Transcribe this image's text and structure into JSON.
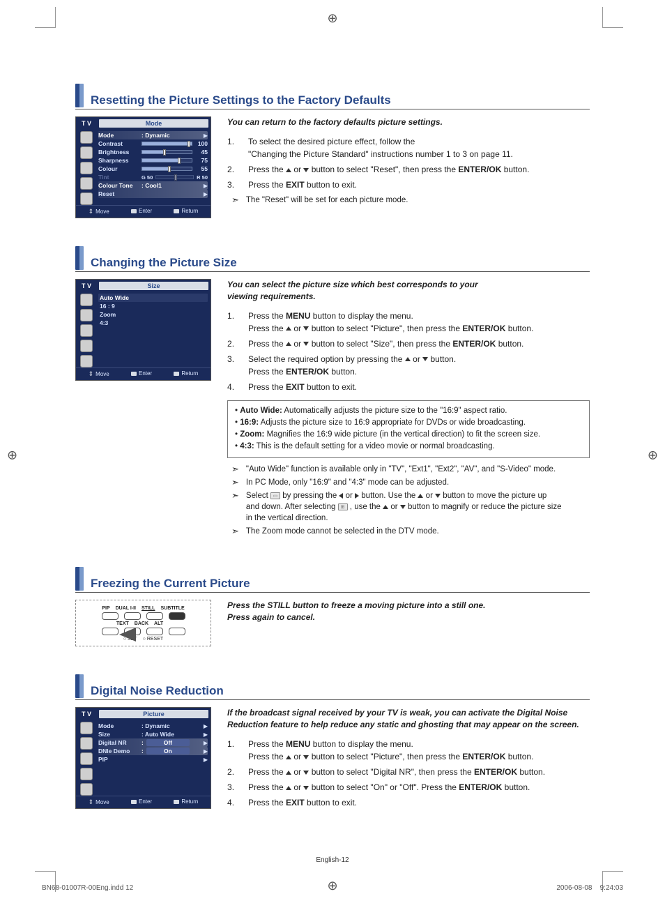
{
  "sections": {
    "s1": {
      "title": "Resetting the Picture Settings to the Factory Defaults",
      "intro": "You can return to the factory defaults picture settings.",
      "osd": {
        "tv": "T V",
        "menu_title": "Mode",
        "rows": {
          "mode": {
            "label": "Mode",
            "value": ": Dynamic"
          },
          "contrast": {
            "label": "Contrast",
            "num": "100"
          },
          "brightness": {
            "label": "Brightness",
            "num": "45"
          },
          "sharpness": {
            "label": "Sharpness",
            "num": "75"
          },
          "colour": {
            "label": "Colour",
            "num": "55"
          },
          "tint": {
            "label": "Tint",
            "left": "G 50",
            "right": "R 50"
          },
          "colour_tone": {
            "label": "Colour Tone",
            "value": ": Cool1"
          },
          "reset": {
            "label": "Reset"
          }
        },
        "foot": {
          "move": "Move",
          "enter": "Enter",
          "ret": "Return"
        }
      },
      "steps": {
        "i1": "To select the desired picture effect, follow the",
        "i1b": "\"Changing the Picture Standard\" instructions number 1 to 3 on page 11.",
        "i2a": "Press the ",
        "i2b": " or ",
        "i2c": " button to select \"Reset\", then press the ",
        "i2d": "ENTER/OK",
        "i2e": " button.",
        "i3a": "Press the ",
        "i3b": "EXIT",
        "i3c": " button to exit."
      },
      "note": "The \"Reset\" will be set for each picture mode."
    },
    "s2": {
      "title": "Changing the Picture Size",
      "intro_a": "You can select the picture size which best corresponds to your",
      "intro_b": "viewing requirements.",
      "osd": {
        "tv": "T V",
        "menu_title": "Size",
        "items": {
          "i0": "Auto Wide",
          "i1": "16 : 9",
          "i2": "Zoom",
          "i3": "4:3"
        },
        "foot": {
          "move": "Move",
          "enter": "Enter",
          "ret": "Return"
        }
      },
      "steps": {
        "i1a": "Press the ",
        "i1b": "MENU",
        "i1c": " button to display the menu.",
        "i1d": "Press the ",
        "i1e": " or ",
        "i1f": " button to select \"Picture\", then press the ",
        "i1g": "ENTER/OK",
        "i1h": " button.",
        "i2a": "Press the ",
        "i2b": " or ",
        "i2c": " button to select \"Size\", then press the ",
        "i2d": "ENTER/OK",
        "i2e": " button.",
        "i3a": "Select the required option by pressing the ",
        "i3b": " or ",
        "i3c": " button.",
        "i3d": "Press the ",
        "i3e": "ENTER/OK",
        "i3f": " button.",
        "i4a": "Press the ",
        "i4b": "EXIT",
        "i4c": " button to exit."
      },
      "box": {
        "b1a": "Auto Wide:",
        "b1b": " Automatically adjusts the picture size to the \"16:9\" aspect ratio.",
        "b2a": "16:9:",
        "b2b": " Adjusts the picture size to 16:9 appropriate for DVDs or wide broadcasting.",
        "b3a": "Zoom:",
        "b3b": " Magnifies the 16:9 wide picture (in the vertical direction) to fit the screen size.",
        "b4a": "4:3:",
        "b4b": " This is the default setting for a video movie or normal broadcasting."
      },
      "notes": {
        "n1": "\"Auto Wide\" function is available only in \"TV\", \"Ext1\", \"Ext2\", \"AV\", and \"S-Video\" mode.",
        "n2": "In PC Mode, only \"16:9\" and \"4:3\" mode can be adjusted.",
        "n3a": "Select ",
        "n3b": " by pressing the ",
        "n3c": " or ",
        "n3d": " button. Use the ",
        "n3e": " or ",
        "n3f": " button to move the picture up",
        "n3g": "and down.  After selecting ",
        "n3h": " , use the ",
        "n3i": " or ",
        "n3j": " button to magnify or reduce the picture size",
        "n3k": "in the vertical direction.",
        "n4": "The Zoom mode cannot be selected in the DTV mode."
      }
    },
    "s3": {
      "title": "Freezing the Current Picture",
      "intro_a": "Press the STILL button to freeze a moving picture into a still one.",
      "intro_b": "Press again to cancel.",
      "remote": {
        "row1": {
          "a": "PIP",
          "b": "DUAL I-II",
          "c": "STILL",
          "d": "SUBTITLE"
        },
        "row3": {
          "a": "TEXT",
          "b": "BACK",
          "c": "ALT"
        },
        "row5": {
          "a": "SET",
          "b": "RESET"
        }
      }
    },
    "s4": {
      "title": "Digital Noise Reduction",
      "intro": "If the broadcast signal received by your TV is weak, you can activate the Digital Noise Reduction feature to help reduce any static and ghosting that may appear on the screen.",
      "osd": {
        "tv": "T V",
        "menu_title": "Picture",
        "rows": {
          "mode": {
            "label": "Mode",
            "value": ": Dynamic"
          },
          "size": {
            "label": "Size",
            "value": ": Auto Wide"
          },
          "dnr": {
            "label": "Digital NR",
            "value": "Off"
          },
          "dnie": {
            "label": "DNIe Demo",
            "value": "On"
          },
          "pip": {
            "label": "PIP"
          }
        },
        "foot": {
          "move": "Move",
          "enter": "Enter",
          "ret": "Return"
        }
      },
      "steps": {
        "i1a": "Press the ",
        "i1b": "MENU",
        "i1c": " button to display the menu.",
        "i1d": "Press the ",
        "i1e": " or ",
        "i1f": " button to select \"Picture\", then press the ",
        "i1g": "ENTER/OK",
        "i1h": " button.",
        "i2a": "Press the ",
        "i2b": " or ",
        "i2c": " button to select \"Digital NR\", then press the ",
        "i2d": "ENTER/OK",
        "i2e": " button.",
        "i3a": "Press the ",
        "i3b": " or ",
        "i3c": " button to select \"On\" or \"Off\". Press the ",
        "i3d": "ENTER/OK",
        "i3e": " button.",
        "i4a": "Press the ",
        "i4b": "EXIT",
        "i4c": " button to exit."
      }
    }
  },
  "footer": {
    "center": "English-12",
    "left": "BN68-01007R-00Eng.indd   12",
    "right_date": "2006-08-08",
    "right_time": "9:24:03"
  }
}
